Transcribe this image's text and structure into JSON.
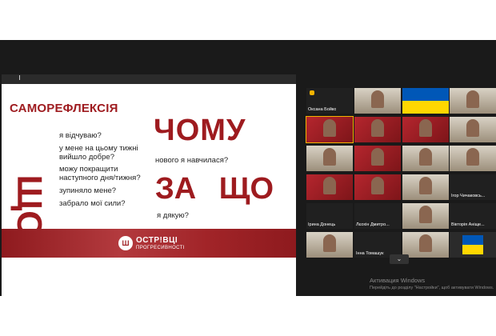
{
  "slide": {
    "title": "САМОРЕФЛЕКСІЯ",
    "big_left": "ЩО",
    "left_questions": [
      "я відчуваю?",
      "у мене на цьому тижні вийшло добре?",
      "можу покращити наступного дня/тижня?",
      "зупиняло мене?",
      "забрало мої сили?"
    ],
    "why_word": "ЧОМУ",
    "why_question": "нового я навчилася?",
    "forwhat_word": "ЗА ЩО",
    "forwhat_question": "я дякую?",
    "logo_line1": "ОСТР!ВЦІ",
    "logo_line2": "ПРОГРЕСИВНОСТІ"
  },
  "participants": [
    {
      "name": "Оксана Бойко",
      "style": "dark",
      "hand": true
    },
    {
      "name": "",
      "style": "room"
    },
    {
      "name": "",
      "style": "flag"
    },
    {
      "name": "",
      "style": "room"
    },
    {
      "name": "",
      "style": "red",
      "active": true
    },
    {
      "name": "",
      "style": "red"
    },
    {
      "name": "",
      "style": "red"
    },
    {
      "name": "",
      "style": "room"
    },
    {
      "name": "",
      "style": "room"
    },
    {
      "name": "",
      "style": "red"
    },
    {
      "name": "",
      "style": "room"
    },
    {
      "name": "",
      "style": "room"
    },
    {
      "name": "",
      "style": "red"
    },
    {
      "name": "",
      "style": "red"
    },
    {
      "name": "",
      "style": "room"
    },
    {
      "name": "Ігор Чичаковсь...",
      "style": "dark"
    },
    {
      "name": "Ірина Донець",
      "style": "dark"
    },
    {
      "name": "Лєохін Дмитро...",
      "style": "dark"
    },
    {
      "name": "",
      "style": "room"
    },
    {
      "name": "Вікторія Аніще...",
      "style": "dark"
    },
    {
      "name": "",
      "style": "room"
    },
    {
      "name": "Інна Томашук",
      "style": "dark"
    },
    {
      "name": "",
      "style": "room"
    },
    {
      "name": "",
      "style": "flagbox"
    }
  ],
  "gallery_nav": {
    "icon": "chevron-down-icon",
    "glyph": "⌄"
  },
  "activation": {
    "line1": "Активация Windows",
    "line2": "Перейдіть до розділу \"Настройки\", щоб активувати Windows."
  }
}
